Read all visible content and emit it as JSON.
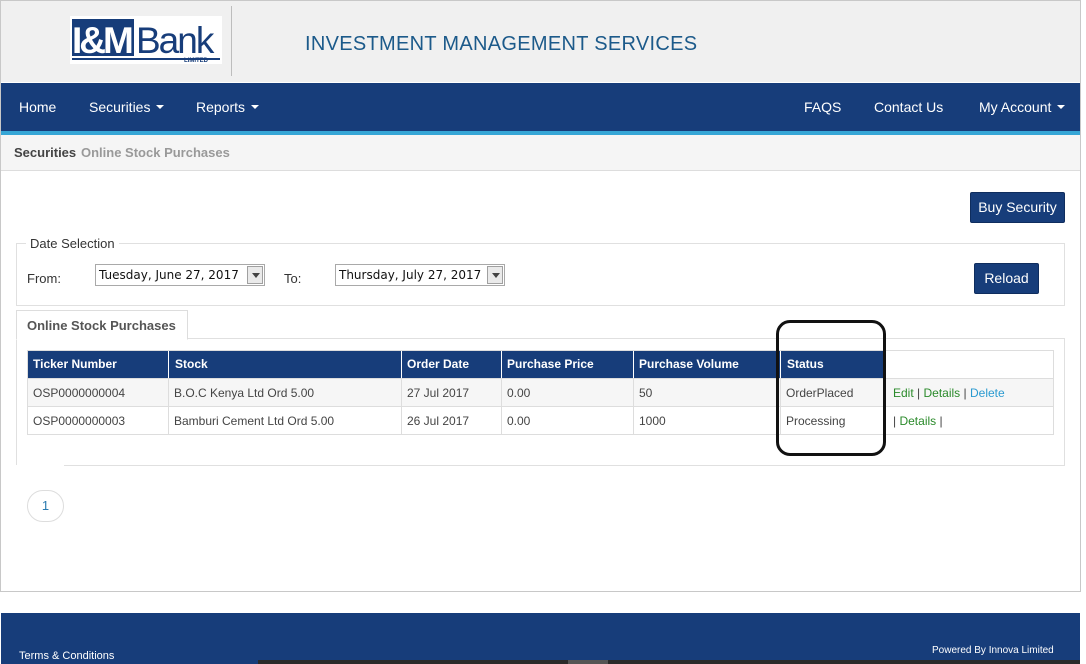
{
  "header": {
    "logo_text": "I&MBank",
    "logo_sub": "LIMITED",
    "title": "INVESTMENT MANAGEMENT SERVICES"
  },
  "nav": {
    "home": "Home",
    "securities": "Securities",
    "reports": "Reports",
    "faqs": "FAQS",
    "contact": "Contact Us",
    "account": "My Account"
  },
  "breadcrumb": {
    "section": "Securities",
    "page": "Online Stock Purchases"
  },
  "actions": {
    "buy": "Buy Security",
    "reload": "Reload"
  },
  "date_selection": {
    "legend": "Date Selection",
    "from_label": "From:",
    "from_value": "Tuesday, June 27, 2017",
    "to_label": "To:",
    "to_value": "Thursday, July 27, 2017"
  },
  "tab": {
    "label": "Online Stock Purchases"
  },
  "table": {
    "headers": [
      "Ticker Number",
      "Stock",
      "Order Date",
      "Purchase Price",
      "Purchase Volume",
      "Status"
    ],
    "rows": [
      {
        "ticker": "OSP0000000004",
        "stock": "B.O.C Kenya Ltd Ord 5.00",
        "date": "27 Jul 2017",
        "price": "0.00",
        "volume": "50",
        "status": "OrderPlaced",
        "edit": "Edit",
        "details": "Details",
        "delete": "Delete"
      },
      {
        "ticker": "OSP0000000003",
        "stock": "Bamburi Cement Ltd Ord 5.00",
        "date": "26 Jul 2017",
        "price": "0.00",
        "volume": "1000",
        "status": "Processing",
        "details": "Details"
      }
    ]
  },
  "pager": {
    "current": "1"
  },
  "footer": {
    "terms": "Terms & Conditions",
    "powered": "Powered By Innova Limited"
  },
  "colors": {
    "brand": "#173d7a",
    "accent": "#36a6d6",
    "link_green": "#2a8a2a",
    "link_blue": "#2a9ad0"
  }
}
